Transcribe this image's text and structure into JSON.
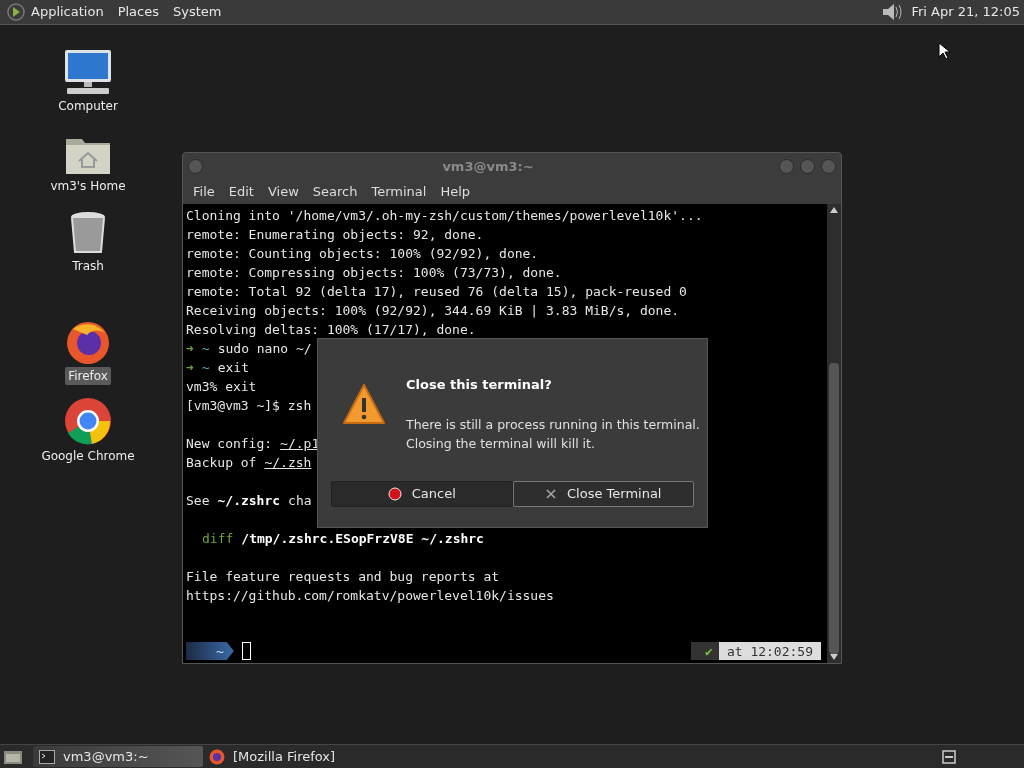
{
  "top_panel": {
    "menus": [
      "Application",
      "Places",
      "System"
    ],
    "clock": "Fri Apr 21, 12:05"
  },
  "desktop_icons": [
    {
      "kind": "computer",
      "label": "Computer",
      "selected": false
    },
    {
      "kind": "home",
      "label": "vm3's Home",
      "selected": false
    },
    {
      "kind": "trash",
      "label": "Trash",
      "selected": false
    },
    {
      "kind": "firefox",
      "label": "Firefox",
      "selected": true
    },
    {
      "kind": "chrome",
      "label": "Google Chrome",
      "selected": false
    }
  ],
  "terminal": {
    "title": "vm3@vm3:~",
    "menu": [
      "File",
      "Edit",
      "View",
      "Search",
      "Terminal",
      "Help"
    ],
    "lines": [
      {
        "kind": "text",
        "segments": [
          {
            "kind": "plain",
            "text": "Cloning into '/home/vm3/.oh-my-zsh/custom/themes/powerlevel10k'..."
          }
        ]
      },
      {
        "kind": "text",
        "segments": [
          {
            "kind": "plain",
            "text": "remote: Enumerating objects: 92, done."
          }
        ]
      },
      {
        "kind": "text",
        "segments": [
          {
            "kind": "plain",
            "text": "remote: Counting objects: 100% (92/92), done."
          }
        ]
      },
      {
        "kind": "text",
        "segments": [
          {
            "kind": "plain",
            "text": "remote: Compressing objects: 100% (73/73), done."
          }
        ]
      },
      {
        "kind": "text",
        "segments": [
          {
            "kind": "plain",
            "text": "remote: Total 92 (delta 17), reused 76 (delta 15), pack-reused 0"
          }
        ]
      },
      {
        "kind": "text",
        "segments": [
          {
            "kind": "plain",
            "text": "Receiving objects: 100% (92/92), 344.69 KiB | 3.83 MiB/s, done."
          }
        ]
      },
      {
        "kind": "text",
        "segments": [
          {
            "kind": "plain",
            "text": "Resolving deltas: 100% (17/17), done."
          }
        ]
      },
      {
        "kind": "text",
        "segments": [
          {
            "kind": "green",
            "text": "➜"
          },
          {
            "kind": "cyan",
            "text": "~"
          },
          {
            "kind": "plain",
            "text": "sudo nano ~/"
          }
        ]
      },
      {
        "kind": "text",
        "segments": [
          {
            "kind": "green",
            "text": "➜"
          },
          {
            "kind": "cyan",
            "text": "~"
          },
          {
            "kind": "plain",
            "text": "exit"
          }
        ]
      },
      {
        "kind": "text",
        "segments": [
          {
            "kind": "plain",
            "text": "vm3% exit"
          }
        ]
      },
      {
        "kind": "text",
        "segments": [
          {
            "kind": "plain",
            "text": "[vm3@vm3 ~]$ zsh"
          }
        ]
      },
      {
        "kind": "blank"
      },
      {
        "kind": "text",
        "segments": [
          {
            "kind": "plain",
            "text": "New config:"
          },
          {
            "kind": "underline",
            "text": "~/.p1"
          }
        ]
      },
      {
        "kind": "text",
        "segments": [
          {
            "kind": "plain",
            "text": "Backup of"
          },
          {
            "kind": "underline",
            "text": "~/.zsh"
          }
        ]
      },
      {
        "kind": "blank"
      },
      {
        "kind": "text",
        "segments": [
          {
            "kind": "plain",
            "text": "See"
          },
          {
            "kind": "bold",
            "text": "~/.zshrc"
          },
          {
            "kind": "plain",
            "text": "cha"
          }
        ]
      },
      {
        "kind": "blank"
      },
      {
        "kind": "indented",
        "segments": [
          {
            "kind": "green",
            "text": "diff"
          },
          {
            "kind": "bold",
            "text": "/tmp/.zshrc.ESopFrzV8E ~/.zshrc"
          }
        ]
      },
      {
        "kind": "blank"
      },
      {
        "kind": "text",
        "segments": [
          {
            "kind": "plain",
            "text": "File feature requests and bug reports at"
          }
        ]
      },
      {
        "kind": "text",
        "segments": [
          {
            "kind": "plain",
            "text": "https://github.com/romkatv/powerlevel10k/issues"
          }
        ]
      }
    ],
    "prompt": {
      "dir": "~",
      "status": "✔",
      "time": "at 12:02:59"
    }
  },
  "dialog": {
    "title": "Close this terminal?",
    "message": "There is still a process running in this terminal.\nClosing the terminal will kill it.",
    "buttons": [
      {
        "kind": "cancel",
        "label": "Cancel",
        "selected": false
      },
      {
        "kind": "close",
        "label": "Close Terminal",
        "selected": true
      }
    ]
  },
  "taskbar": {
    "tasks": [
      {
        "kind": "terminal",
        "label": "vm3@vm3:~",
        "selected": true
      },
      {
        "kind": "firefox",
        "label": "[Mozilla Firefox]",
        "selected": false
      }
    ]
  }
}
